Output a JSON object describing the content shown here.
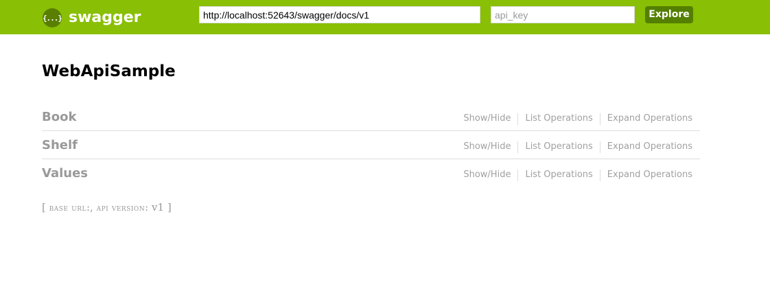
{
  "header": {
    "logo_glyph": "{...}",
    "logo_text": "swagger",
    "url_value": "http://localhost:52643/swagger/docs/v1",
    "api_key_placeholder": "api_key",
    "explore_label": "Explore",
    "colors": {
      "header_bg": "#89bf04",
      "explore_bg": "#547f00"
    }
  },
  "main": {
    "title": "WebApiSample",
    "resources": [
      {
        "name": "Book",
        "show_hide": "Show/Hide",
        "list_ops": "List Operations",
        "expand_ops": "Expand Operations"
      },
      {
        "name": "Shelf",
        "show_hide": "Show/Hide",
        "list_ops": "List Operations",
        "expand_ops": "Expand Operations"
      },
      {
        "name": "Values",
        "show_hide": "Show/Hide",
        "list_ops": "List Operations",
        "expand_ops": "Expand Operations"
      }
    ]
  },
  "footer": {
    "open_bracket": "[",
    "base_url_label": "base url",
    "base_url_value": ":",
    "comma": ",",
    "api_version_label": "api version",
    "api_version_sep": ":",
    "api_version_value": "v1",
    "close_bracket": "]"
  }
}
